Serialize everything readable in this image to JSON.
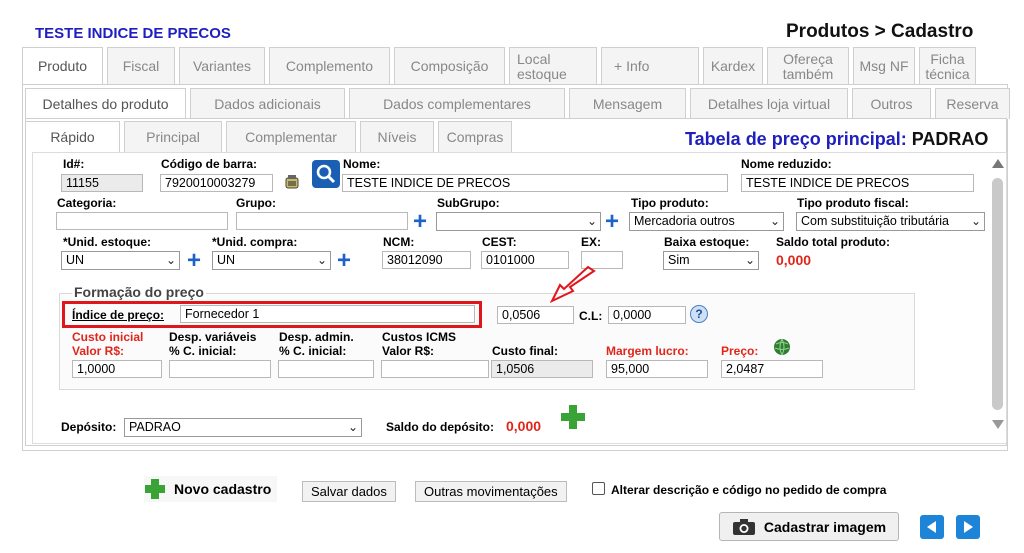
{
  "header": {
    "company": "TESTE INDICE DE PRECOS",
    "breadcrumb": "Produtos > Cadastro"
  },
  "main_tabs": [
    {
      "label": "Produto",
      "active": true
    },
    {
      "label": "Fiscal"
    },
    {
      "label": "Variantes"
    },
    {
      "label": "Complemento"
    },
    {
      "label": "Composição"
    },
    {
      "label": "Local estoque"
    },
    {
      "label": "+ Info"
    },
    {
      "label": "Kardex"
    },
    {
      "label": "Ofereça também"
    },
    {
      "label": "Msg NF"
    },
    {
      "label": "Ficha técnica"
    }
  ],
  "sub_tabs": [
    {
      "label": "Detalhes do produto",
      "active": true
    },
    {
      "label": "Dados adicionais"
    },
    {
      "label": "Dados complementares"
    },
    {
      "label": "Mensagem"
    },
    {
      "label": "Detalhes loja virtual"
    },
    {
      "label": "Outros"
    },
    {
      "label": "Reserva"
    }
  ],
  "inner_tabs": [
    {
      "label": "Rápido",
      "active": true
    },
    {
      "label": "Principal"
    },
    {
      "label": "Complementar"
    },
    {
      "label": "Níveis"
    },
    {
      "label": "Compras"
    }
  ],
  "price_table": {
    "label": "Tabela de preço principal:",
    "value": "PADRAO"
  },
  "form": {
    "id_label": "Id#:",
    "id_value": "11155",
    "barcode_label": "Código de barra:",
    "barcode_value": "7920010003279",
    "name_label": "Nome:",
    "name_value": "TESTE INDICE DE PRECOS",
    "short_name_label": "Nome reduzido:",
    "short_name_value": "TESTE INDICE DE PRECOS",
    "category_label": "Categoria:",
    "category_value": "",
    "group_label": "Grupo:",
    "group_value": "",
    "subgroup_label": "SubGrupo:",
    "subgroup_value": "",
    "product_type_label": "Tipo produto:",
    "product_type_value": "Mercadoria outros",
    "fiscal_type_label": "Tipo produto fiscal:",
    "fiscal_type_value": "Com substituição tributária",
    "stock_unit_label": "*Unid. estoque:",
    "stock_unit_value": "UN",
    "purchase_unit_label": "*Unid. compra:",
    "purchase_unit_value": "UN",
    "ncm_label": "NCM:",
    "ncm_value": "38012090",
    "cest_label": "CEST:",
    "cest_value": "0101000",
    "ex_label": "EX:",
    "ex_value": "",
    "stock_down_label": "Baixa estoque:",
    "stock_down_value": "Sim",
    "total_balance_label": "Saldo total produto:",
    "total_balance_value": "0,000"
  },
  "pricing": {
    "section_title": "Formação do preço",
    "index_label": "Índice de preço:",
    "index_value": "Fornecedor 1",
    "index_factor": "0,0506",
    "cl_label": "C.L:",
    "cl_value": "0,0000",
    "help_glyph": "?",
    "cost_label_1": "Custo inicial",
    "cost_label_2": "Valor R$:",
    "cost_value": "1,0000",
    "var_label_1": "Desp. variáveis",
    "var_label_2": "% C. inicial:",
    "var_value": "",
    "adm_label_1": "Desp. admin.",
    "adm_label_2": "% C. inicial:",
    "adm_value": "",
    "icms_label_1": "Custos ICMS",
    "icms_label_2": "Valor R$:",
    "icms_value": "",
    "final_cost_label": "Custo final:",
    "final_cost_value": "1,0506",
    "margin_label": "Margem lucro:",
    "margin_value": "95,000",
    "price_label": "Preço:",
    "price_value": "2,0487"
  },
  "deposit": {
    "label": "Depósito:",
    "value": "PADRAO",
    "balance_label": "Saldo do depósito:",
    "balance_value": "0,000"
  },
  "footer": {
    "new_label": "Novo cadastro",
    "save_label": "Salvar dados",
    "other_label": "Outras movimentações",
    "checkbox_label": "Alterar descrição e código no pedido de compra",
    "checkbox_checked": false,
    "image_label": "Cadastrar imagem"
  },
  "colors": {
    "accent_blue": "#1f1fbf",
    "red": "#e0261b",
    "plus_blue": "#1e62c8",
    "green": "#3aa335",
    "highlight_red": "#e0161b"
  },
  "icons": [
    "search-icon",
    "barcode-icon",
    "plus-icon",
    "help-icon",
    "globe-icon",
    "camera-icon",
    "arrow-left-icon",
    "arrow-right-icon",
    "pointer-arrow-icon"
  ]
}
